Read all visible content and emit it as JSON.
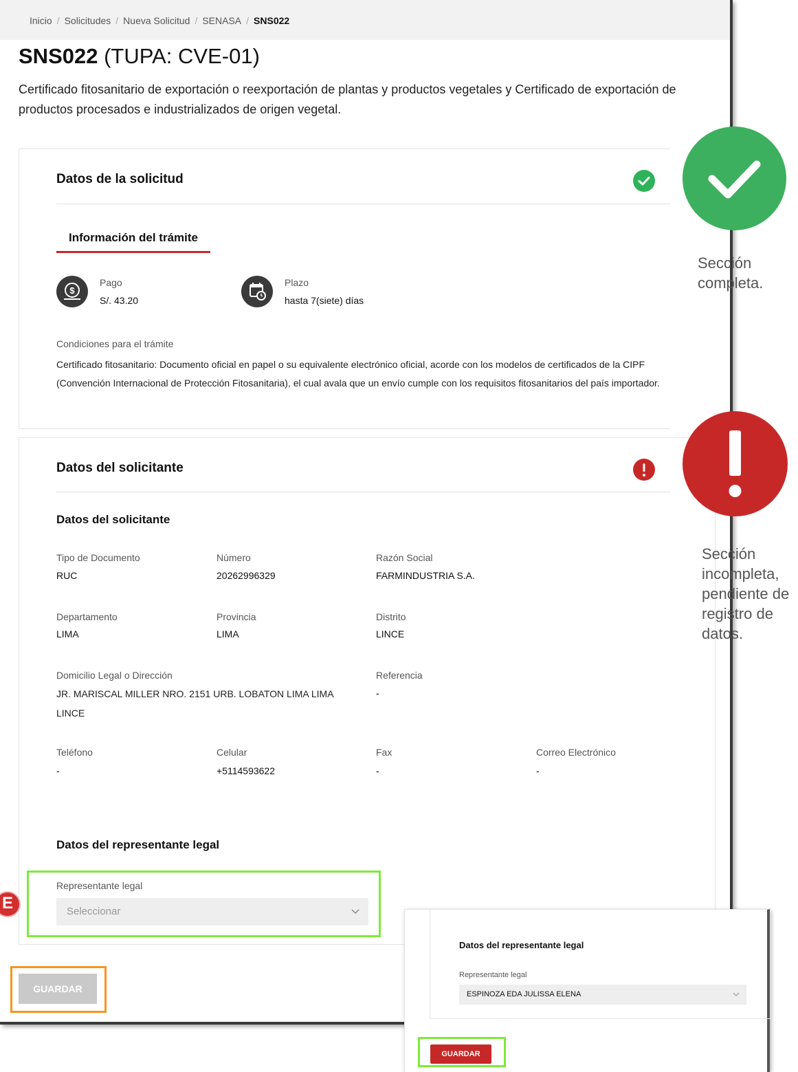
{
  "breadcrumb": [
    "Inicio",
    "Solicitudes",
    "Nueva Solicitud",
    "SENASA"
  ],
  "breadcrumb_current": "SNS022",
  "page": {
    "code": "SNS022",
    "tupa": "(TUPA: CVE-01)",
    "description": "Certificado fitosanitario de exportación o reexportación de plantas y productos vegetales y Certificado de exportación de productos procesados e industrializados de origen vegetal."
  },
  "solicitud": {
    "title": "Datos de la solicitud",
    "tab": "Información del trámite",
    "pago_label": "Pago",
    "pago_value": "S/. 43.20",
    "plazo_label": "Plazo",
    "plazo_value": "hasta 7(siete) días",
    "condiciones_label": "Condiciones para el trámite",
    "condiciones_text": "Certificado fitosanitario: Documento oficial en papel o su equivalente electrónico oficial, acorde con los modelos de certificados de la CIPF (Convención Internacional de Protección Fitosanitaria), el cual avala que un envío cumple con los requisitos fitosanitarios del país importador."
  },
  "solicitante": {
    "title": "Datos del solicitante",
    "subtitle": "Datos del solicitante",
    "fields": {
      "tipo_doc_label": "Tipo de Documento",
      "tipo_doc_value": "RUC",
      "numero_label": "Número",
      "numero_value": "20262996329",
      "razon_label": "Razón Social",
      "razon_value": "FARMINDUSTRIA S.A.",
      "departamento_label": "Departamento",
      "departamento_value": "LIMA",
      "provincia_label": "Provincia",
      "provincia_value": "LIMA",
      "distrito_label": "Distrito",
      "distrito_value": "LINCE",
      "domicilio_label": "Domicilio Legal o Dirección",
      "domicilio_value": "JR. MARISCAL MILLER NRO. 2151 URB. LOBATON LIMA LIMA LINCE",
      "referencia_label": "Referencia",
      "referencia_value": "-",
      "telefono_label": "Teléfono",
      "telefono_value": "-",
      "celular_label": "Celular",
      "celular_value": "+5114593622",
      "fax_label": "Fax",
      "fax_value": "-",
      "correo_label": "Correo Electrónico",
      "correo_value": "-"
    }
  },
  "representante": {
    "title": "Datos del representante legal",
    "label": "Representante legal",
    "placeholder": "Seleccionar"
  },
  "marker_letter": "E",
  "save_label": "GUARDAR",
  "callouts": {
    "complete": "Sección completa.",
    "incomplete": "Sección incompleta, pendiente de registro de datos."
  },
  "inset": {
    "title": "Datos del representante legal",
    "label": "Representante legal",
    "value": "ESPINOZA EDA JULISSA ELENA",
    "save_label": "GUARDAR"
  },
  "colors": {
    "success": "#3cb05e",
    "error": "#c62828",
    "highlight_green": "#7ee93a",
    "highlight_orange": "#f7941d"
  }
}
